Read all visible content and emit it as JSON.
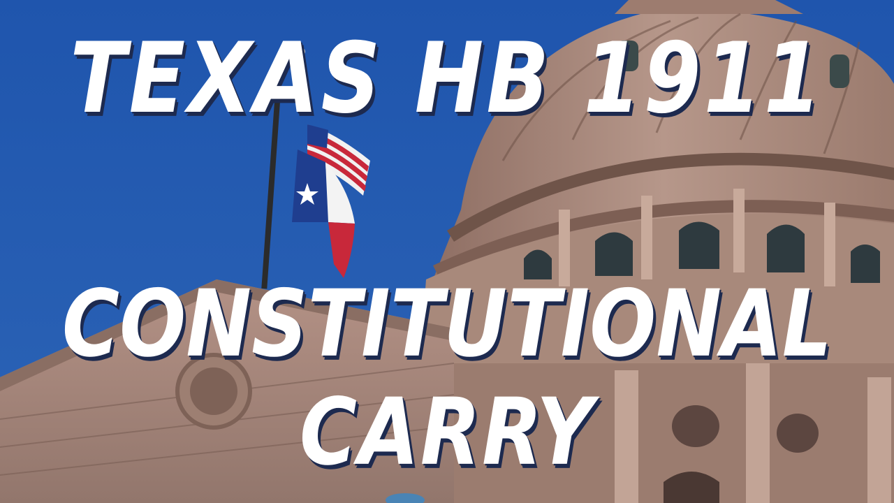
{
  "headline": {
    "line1": "TEXAS HB 1911",
    "line2": "CONSTITUTIONAL",
    "line3": "CARRY"
  },
  "colors": {
    "sky": "#2f5fa9",
    "granite": "#a88a7b",
    "granite_dark": "#7b5e53",
    "text": "#ffffff",
    "text_shadow": "#1d2a4f",
    "flag_red": "#c8283a",
    "flag_blue": "#1f3e8f"
  },
  "image": {
    "subjects": [
      "texas-capitol-dome",
      "us-flag",
      "texas-flag",
      "flagpole"
    ]
  }
}
